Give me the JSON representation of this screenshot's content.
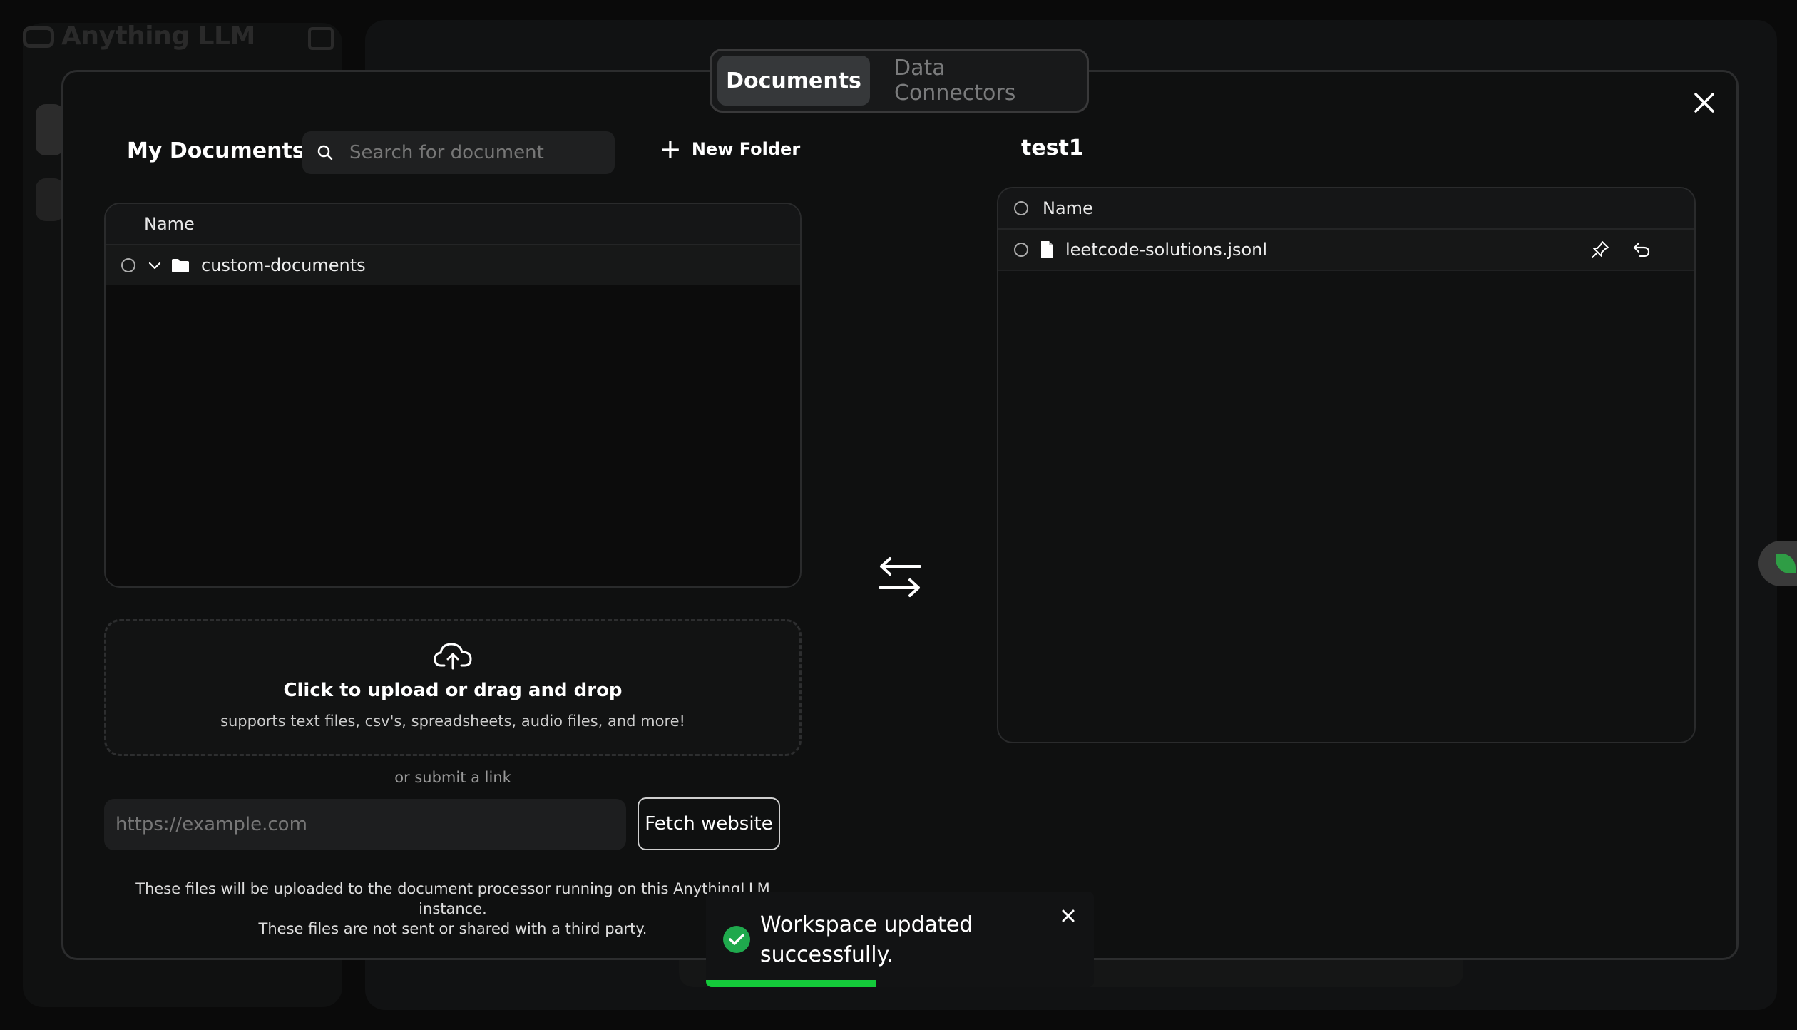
{
  "background": {
    "app_name": "Anything LLM"
  },
  "tabs": [
    {
      "label": "Documents",
      "active": true
    },
    {
      "label": "Data Connectors",
      "active": false
    }
  ],
  "my_documents": {
    "title": "My Documents",
    "search_placeholder": "Search for document",
    "new_folder_label": "New Folder",
    "column_name": "Name",
    "folders": [
      {
        "name": "custom-documents",
        "expanded": true
      }
    ]
  },
  "upload": {
    "title": "Click to upload or drag and drop",
    "subtitle": "supports text files, csv's, spreadsheets, audio files, and more!",
    "or_submit": "or submit a link",
    "link_placeholder": "https://example.com",
    "fetch_label": "Fetch website",
    "notice_line1": "These files will be uploaded to the document processor running on this AnythingLLM instance.",
    "notice_line2": "These files are not sent or shared with a third party."
  },
  "workspace": {
    "title": "test1",
    "column_name": "Name",
    "files": [
      {
        "name": "leetcode-solutions.jsonl"
      }
    ]
  },
  "toast": {
    "message": "Workspace updated successfully.",
    "progress": 0.44
  },
  "colors": {
    "accent_green": "#14c93a",
    "success_icon": "#1fa94d"
  }
}
